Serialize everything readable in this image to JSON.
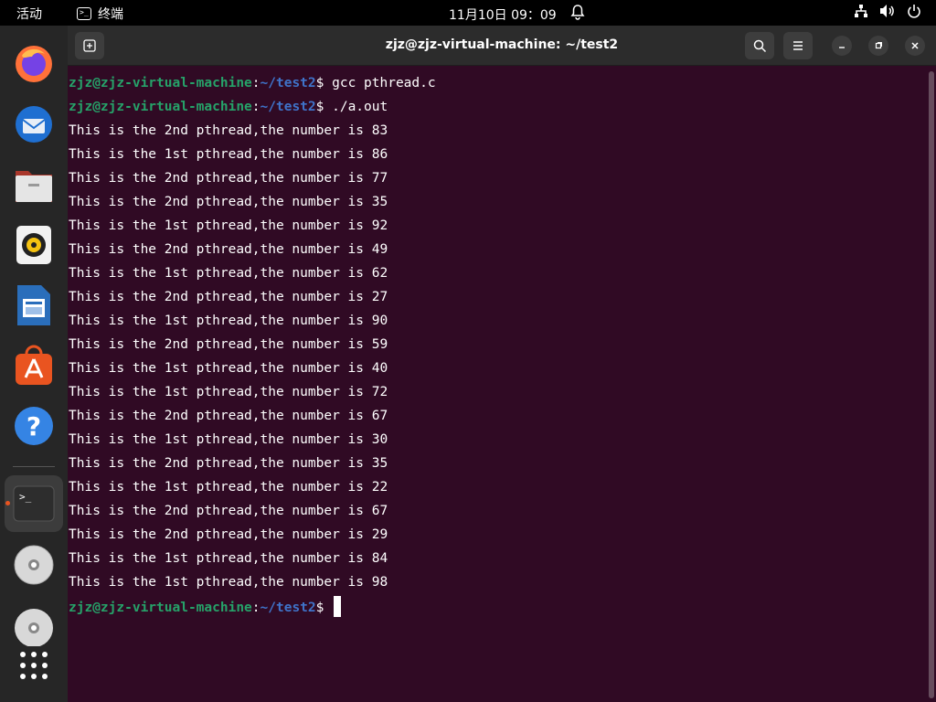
{
  "topbar": {
    "activities": "活动",
    "app_name": "终端",
    "clock": "11月10日  09：09",
    "tray_icons": [
      "network-icon",
      "volume-icon",
      "power-icon"
    ]
  },
  "dock": {
    "items": [
      "firefox",
      "thunderbird",
      "files",
      "rhythmbox",
      "libreoffice-writer",
      "app-center",
      "help",
      "terminal",
      "dvd-drive",
      "dvd-drive-2",
      "show-apps"
    ],
    "active": "terminal"
  },
  "window": {
    "title": "zjz@zjz-virtual-machine: ~/test2"
  },
  "terminal": {
    "prompt_user": "zjz@zjz-virtual-machine",
    "prompt_path": "~/test2",
    "lines": [
      {
        "type": "cmd",
        "text": "gcc pthread.c"
      },
      {
        "type": "cmd",
        "text": "./a.out"
      },
      {
        "type": "out",
        "text": "This is the 2nd pthread,the number is 83"
      },
      {
        "type": "out",
        "text": "This is the 1st pthread,the number is 86"
      },
      {
        "type": "out",
        "text": "This is the 2nd pthread,the number is 77"
      },
      {
        "type": "out",
        "text": "This is the 2nd pthread,the number is 35"
      },
      {
        "type": "out",
        "text": "This is the 1st pthread,the number is 92"
      },
      {
        "type": "out",
        "text": "This is the 2nd pthread,the number is 49"
      },
      {
        "type": "out",
        "text": "This is the 1st pthread,the number is 62"
      },
      {
        "type": "out",
        "text": "This is the 2nd pthread,the number is 27"
      },
      {
        "type": "out",
        "text": "This is the 1st pthread,the number is 90"
      },
      {
        "type": "out",
        "text": "This is the 2nd pthread,the number is 59"
      },
      {
        "type": "out",
        "text": "This is the 1st pthread,the number is 40"
      },
      {
        "type": "out",
        "text": "This is the 1st pthread,the number is 72"
      },
      {
        "type": "out",
        "text": "This is the 2nd pthread,the number is 67"
      },
      {
        "type": "out",
        "text": "This is the 1st pthread,the number is 30"
      },
      {
        "type": "out",
        "text": "This is the 2nd pthread,the number is 35"
      },
      {
        "type": "out",
        "text": "This is the 1st pthread,the number is 22"
      },
      {
        "type": "out",
        "text": "This is the 2nd pthread,the number is 67"
      },
      {
        "type": "out",
        "text": "This is the 2nd pthread,the number is 29"
      },
      {
        "type": "out",
        "text": "This is the 1st pthread,the number is 84"
      },
      {
        "type": "out",
        "text": "This is the 1st pthread,the number is 98"
      },
      {
        "type": "prompt",
        "text": ""
      }
    ]
  },
  "colors": {
    "terminal_bg": "#300a24",
    "prompt_user": "#26a269",
    "prompt_path": "#3f73c9",
    "accent": "#e95420"
  }
}
